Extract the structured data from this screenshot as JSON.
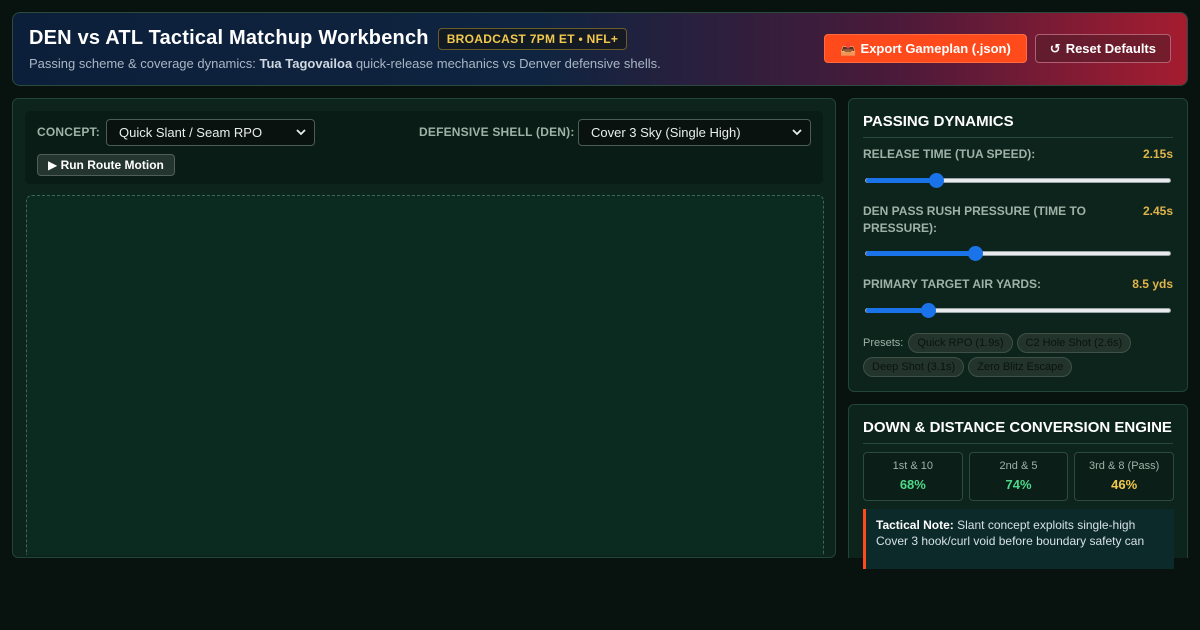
{
  "header": {
    "title": "DEN vs ATL Tactical Matchup Workbench",
    "badge": "BROADCAST 7PM ET • NFL+",
    "subtitle_prefix": "Passing scheme & coverage dynamics: ",
    "subtitle_player": "Tua Tagovailoa",
    "subtitle_suffix": " quick-release mechanics vs Denver defensive shells.",
    "export_icon": "📤",
    "export_label": "Export Gameplan (.json)",
    "reset_icon": "↺",
    "reset_label": "Reset Defaults"
  },
  "controls": {
    "concept_label": "CONCEPT:",
    "concept_value": "Quick Slant / Seam RPO",
    "shell_label": "DEFENSIVE SHELL (DEN):",
    "shell_value": "Cover 3 Sky (Single High)",
    "run_label": "▶ Run Route Motion"
  },
  "passing_dynamics": {
    "title": "PASSING DYNAMICS",
    "sliders": [
      {
        "label": "RELEASE TIME (TUA SPEED):",
        "value_text": "2.15s",
        "fraction": 0.23
      },
      {
        "label": "DEN PASS RUSH PRESSURE (TIME TO PRESSURE):",
        "value_text": "2.45s",
        "fraction": 0.36
      },
      {
        "label": "PRIMARY TARGET AIR YARDS:",
        "value_text": "8.5 yds",
        "fraction": 0.205
      }
    ],
    "presets_label": "Presets:",
    "presets": [
      "Quick RPO (1.9s)",
      "C2 Hole Shot (2.6s)",
      "Deep Shot (3.1s)",
      "Zero Blitz Escape"
    ]
  },
  "conversion": {
    "title": "DOWN & DISTANCE CONVERSION ENGINE",
    "stats": [
      {
        "label": "1st & 10",
        "value": "68%",
        "color": "#4cd98a"
      },
      {
        "label": "2nd & 5",
        "value": "74%",
        "color": "#4cd98a"
      },
      {
        "label": "3rd & 8 (Pass)",
        "value": "46%",
        "color": "#f2c94c"
      }
    ],
    "note_label": "Tactical Note:",
    "note_text": " Slant concept exploits single-high Cover 3 hook/curl void before boundary safety can"
  },
  "colors": {
    "accent_orange": "#ff4a1c",
    "slider_blue": "#1a73e8",
    "value_gold": "#e0b44a"
  }
}
